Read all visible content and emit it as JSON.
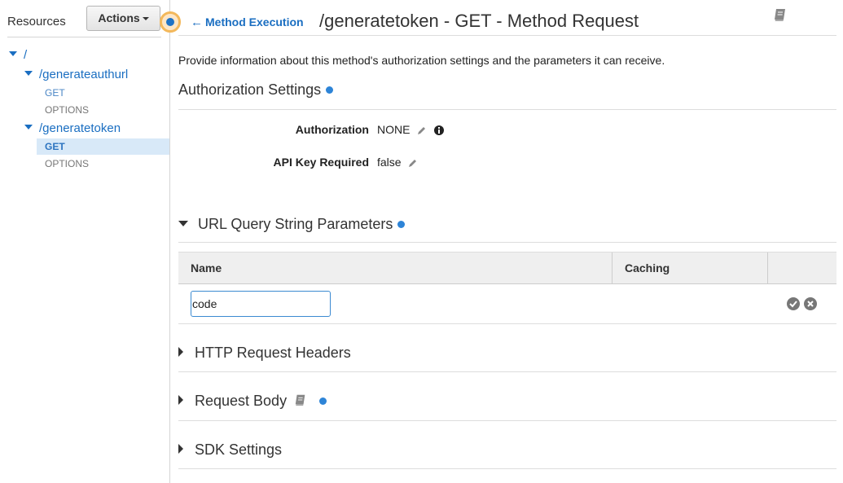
{
  "sidebar": {
    "title": "Resources",
    "actions_label": "Actions",
    "tree": {
      "root": "/",
      "resources": [
        {
          "path": "/generateauthurl",
          "methods": [
            "GET",
            "OPTIONS"
          ]
        },
        {
          "path": "/generatetoken",
          "methods": [
            "GET",
            "OPTIONS"
          ]
        }
      ]
    },
    "selected": "/generatetoken GET"
  },
  "header": {
    "back_label": "Method Execution",
    "title": "/generatetoken - GET - Method Request"
  },
  "description": "Provide information about this method's authorization settings and the parameters it can receive.",
  "authorization": {
    "title": "Authorization Settings",
    "auth_label": "Authorization",
    "auth_value": "NONE",
    "apikey_label": "API Key Required",
    "apikey_value": "false"
  },
  "query_params": {
    "title": "URL Query String Parameters",
    "columns": [
      "Name",
      "Caching"
    ],
    "rows": [
      {
        "name": "code"
      }
    ]
  },
  "sections": {
    "headers": "HTTP Request Headers",
    "body": "Request Body",
    "sdk": "SDK Settings"
  },
  "colors": {
    "link": "#1a6ec1",
    "accent_dot": "#2d84d7",
    "selected_bg": "#d8e9f8",
    "handle_ring": "#f3b85b"
  },
  "icons": [
    "arrow-left-icon",
    "book-icon",
    "pencil-icon",
    "info-icon",
    "check-circle-icon",
    "remove-circle-icon"
  ]
}
